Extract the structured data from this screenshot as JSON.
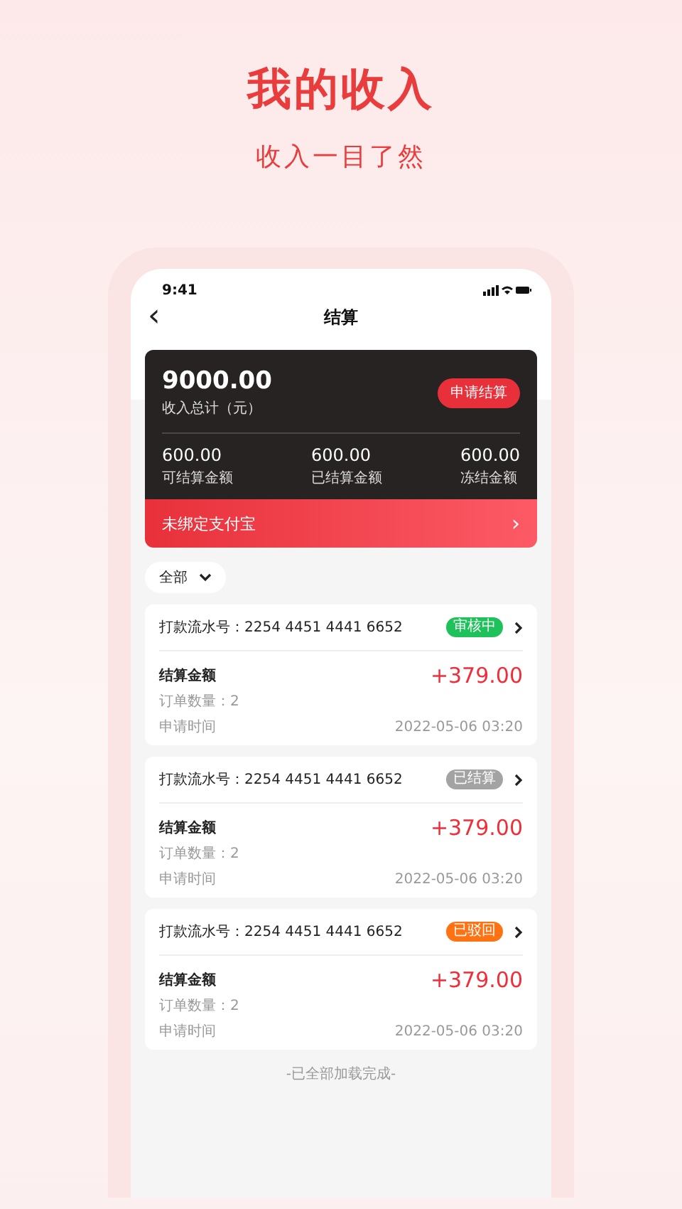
{
  "headline": {
    "title": "我的收入",
    "subtitle": "收入一目了然"
  },
  "status_bar": {
    "time": "9:41"
  },
  "nav": {
    "back": "‹",
    "title": "结算"
  },
  "summary": {
    "total": "9000.00",
    "total_label": "收入总计（元）",
    "action": "申请结算",
    "stats": [
      {
        "value": "600.00",
        "label": "可结算金额"
      },
      {
        "value": "600.00",
        "label": "已结算金额"
      },
      {
        "value": "600.00",
        "label": "冻结金额"
      }
    ]
  },
  "alipay_bar": {
    "label": "未绑定支付宝",
    "chevron": "›"
  },
  "filter": {
    "label": "全部"
  },
  "records": [
    {
      "serial": "打款流水号：2254 4451 4441 6652",
      "status": "审核中",
      "color": "#1fc15a",
      "amount_label": "结算金额",
      "amount": "+379.00",
      "orders": "订单数量：2",
      "time_label": "申请时间",
      "time": "2022-05-06 03:20"
    },
    {
      "serial": "打款流水号：2254 4451 4441 6652",
      "status": "已结算",
      "color": "#a3a3a3",
      "amount_label": "结算金额",
      "amount": "+379.00",
      "orders": "订单数量：2",
      "time_label": "申请时间",
      "time": "2022-05-06 03:20"
    },
    {
      "serial": "打款流水号：2254 4451 4441 6652",
      "status": "已驳回",
      "color": "#ff7214",
      "amount_label": "结算金额",
      "amount": "+379.00",
      "orders": "订单数量：2",
      "time_label": "申请时间",
      "time": "2022-05-06 03:20"
    }
  ],
  "footer": "-已全部加载完成-"
}
